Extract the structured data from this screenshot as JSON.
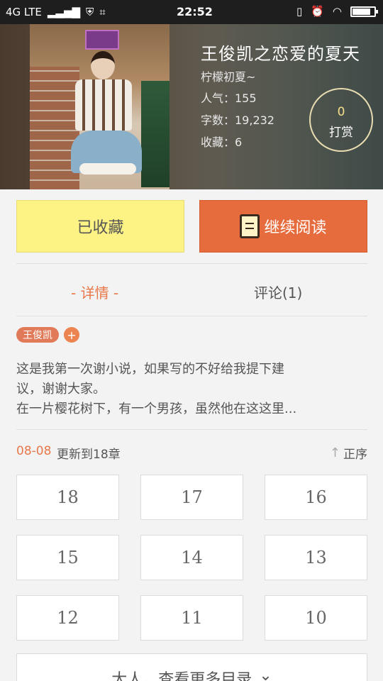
{
  "status_bar": {
    "network": "4G LTE",
    "time": "22:52",
    "battery_level": 0.85
  },
  "book": {
    "title": "王俊凯之恋爱的夏天",
    "author": "柠檬初夏~",
    "popularity_label": "人气：155",
    "word_count_label": "字数：19,232",
    "favorites_label": "收藏：6",
    "tip_count": "0",
    "tip_label": "打赏"
  },
  "actions": {
    "collected_label": "已收藏",
    "continue_label": "继续阅读"
  },
  "tabs": {
    "detail": "- 详情 -",
    "comments": "评论(1)"
  },
  "tags": [
    "王俊凯",
    "+"
  ],
  "description": {
    "line1": "这是我第一次谢小说，如果写的不好给我提下建",
    "line2": "议，谢谢大家。",
    "line3": "在一片樱花树下，有一个男孩，虽然他在这这里..."
  },
  "update": {
    "date": "08-08",
    "text": "更新到18章",
    "sort_label": "正序"
  },
  "chapters": [
    "18",
    "17",
    "16",
    "15",
    "14",
    "13",
    "12",
    "11",
    "10"
  ],
  "more_button": "大人，查看更多目录",
  "colors": {
    "accent": "#e8784a",
    "collect_bg": "#fdf385",
    "read_bg": "#e76c3d"
  }
}
